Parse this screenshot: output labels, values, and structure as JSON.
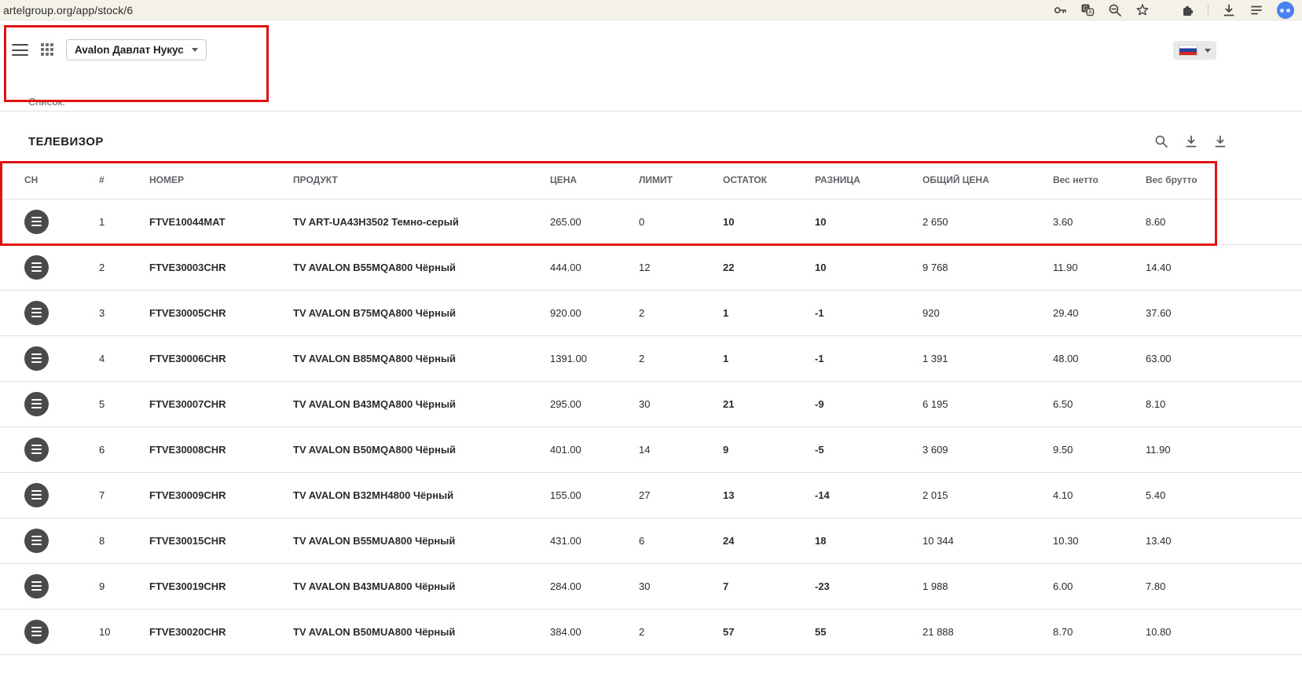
{
  "browser": {
    "url": "artelgroup.org/app/stock/6"
  },
  "appbar": {
    "org_selector_label": "Avalon Давлат Нукус"
  },
  "page": {
    "list_label": "Список:",
    "section_title": "ТЕЛЕВИЗОР"
  },
  "table": {
    "columns": [
      "СН",
      "#",
      "НОМЕР",
      "ПРОДУКТ",
      "ЦЕНА",
      "ЛИМИТ",
      "ОСТАТОК",
      "РАЗНИЦА",
      "ОБЩИЙ ЦЕНА",
      "Вес нетто",
      "Вес брутто"
    ],
    "rows": [
      {
        "index": "1",
        "number": "FTVE10044MAT",
        "product": "TV ART-UA43H3502 Темно-серый",
        "price": "265.00",
        "limit": "0",
        "remainder": "10",
        "remainder_state": "positive",
        "difference": "10",
        "difference_state": "positive",
        "total_price": "2 650",
        "net_weight": "3.60",
        "gross_weight": "8.60"
      },
      {
        "index": "2",
        "number": "FTVE30003CHR",
        "product": "TV AVALON B55MQA800 Чёрный",
        "price": "444.00",
        "limit": "12",
        "remainder": "22",
        "remainder_state": "positive",
        "difference": "10",
        "difference_state": "positive",
        "total_price": "9 768",
        "net_weight": "11.90",
        "gross_weight": "14.40"
      },
      {
        "index": "3",
        "number": "FTVE30005CHR",
        "product": "TV AVALON B75MQA800 Чёрный",
        "price": "920.00",
        "limit": "2",
        "remainder": "1",
        "remainder_state": "negative",
        "difference": "-1",
        "difference_state": "negative",
        "total_price": "920",
        "net_weight": "29.40",
        "gross_weight": "37.60"
      },
      {
        "index": "4",
        "number": "FTVE30006CHR",
        "product": "TV AVALON B85MQA800 Чёрный",
        "price": "1391.00",
        "limit": "2",
        "remainder": "1",
        "remainder_state": "negative",
        "difference": "-1",
        "difference_state": "negative",
        "total_price": "1 391",
        "net_weight": "48.00",
        "gross_weight": "63.00"
      },
      {
        "index": "5",
        "number": "FTVE30007CHR",
        "product": "TV AVALON B43MQA800 Чёрный",
        "price": "295.00",
        "limit": "30",
        "remainder": "21",
        "remainder_state": "negative",
        "difference": "-9",
        "difference_state": "negative",
        "total_price": "6 195",
        "net_weight": "6.50",
        "gross_weight": "8.10"
      },
      {
        "index": "6",
        "number": "FTVE30008CHR",
        "product": "TV AVALON B50MQA800 Чёрный",
        "price": "401.00",
        "limit": "14",
        "remainder": "9",
        "remainder_state": "negative",
        "difference": "-5",
        "difference_state": "negative",
        "total_price": "3 609",
        "net_weight": "9.50",
        "gross_weight": "11.90"
      },
      {
        "index": "7",
        "number": "FTVE30009CHR",
        "product": "TV AVALON B32MH4800 Чёрный",
        "price": "155.00",
        "limit": "27",
        "remainder": "13",
        "remainder_state": "negative",
        "difference": "-14",
        "difference_state": "negative",
        "total_price": "2 015",
        "net_weight": "4.10",
        "gross_weight": "5.40"
      },
      {
        "index": "8",
        "number": "FTVE30015CHR",
        "product": "TV AVALON B55MUA800 Чёрный",
        "price": "431.00",
        "limit": "6",
        "remainder": "24",
        "remainder_state": "positive",
        "difference": "18",
        "difference_state": "positive",
        "total_price": "10 344",
        "net_weight": "10.30",
        "gross_weight": "13.40"
      },
      {
        "index": "9",
        "number": "FTVE30019CHR",
        "product": "TV AVALON B43MUA800 Чёрный",
        "price": "284.00",
        "limit": "30",
        "remainder": "7",
        "remainder_state": "negative",
        "difference": "-23",
        "difference_state": "negative",
        "total_price": "1 988",
        "net_weight": "6.00",
        "gross_weight": "7.80"
      },
      {
        "index": "10",
        "number": "FTVE30020CHR",
        "product": "TV AVALON B50MUA800 Чёрный",
        "price": "384.00",
        "limit": "2",
        "remainder": "57",
        "remainder_state": "positive",
        "difference": "55",
        "difference_state": "positive",
        "total_price": "21 888",
        "net_weight": "8.70",
        "gross_weight": "10.80"
      }
    ]
  },
  "icons": {
    "key-icon": "key",
    "translate-icon": "translate",
    "zoom-icon": "magnifier-minus",
    "bookmark-star-icon": "star-outline",
    "extensions-icon": "puzzle",
    "browser-download-icon": "arrow-down-bar",
    "reading-list-icon": "lines",
    "profile-avatar": "blue-circle-face",
    "menu-icon": "hamburger-lines",
    "apps-grid-icon": "grid-3x3",
    "language-flag-icon": "russian-flag",
    "search-icon": "magnifier",
    "download-icon": "arrow-down-bar",
    "export-icon": "arrow-down-bar",
    "row-menu-icon": "white-lines"
  },
  "colors": {
    "positive": "#0e930e",
    "negative": "#f21212",
    "annotation": "#e01313"
  }
}
